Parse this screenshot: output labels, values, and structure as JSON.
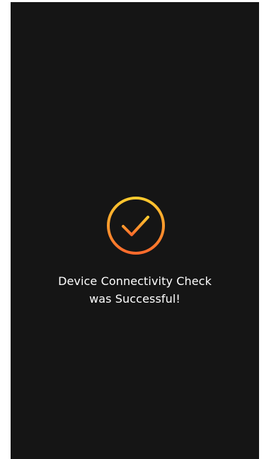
{
  "screen": {
    "background_color": "#151515",
    "success_icon": {
      "name": "check-circle-icon",
      "gradient_top": "#FFCB2E",
      "gradient_bottom": "#FF6A2C"
    },
    "message": {
      "line1": "Device Connectivity Check",
      "line2": "was Successful!"
    }
  }
}
